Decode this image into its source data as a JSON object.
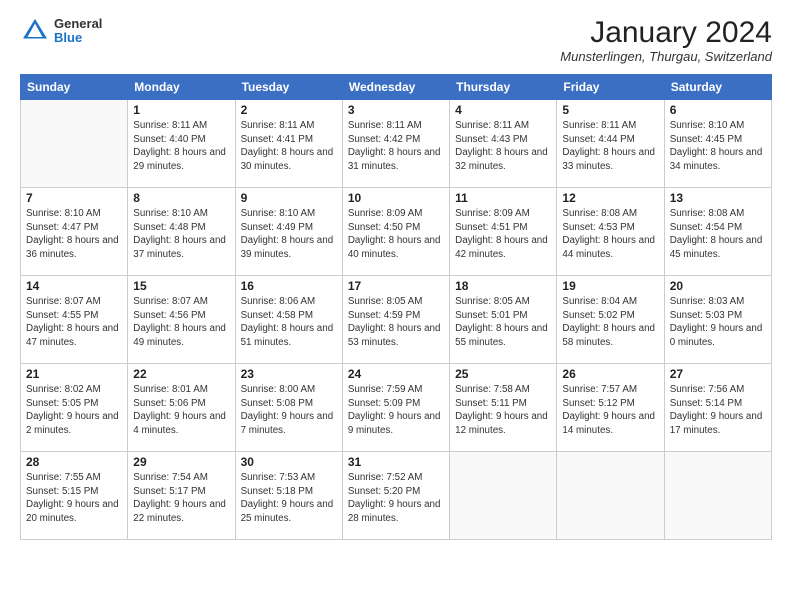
{
  "header": {
    "logo_general": "General",
    "logo_blue": "Blue",
    "month_title": "January 2024",
    "location": "Munsterlingen, Thurgau, Switzerland"
  },
  "weekdays": [
    "Sunday",
    "Monday",
    "Tuesday",
    "Wednesday",
    "Thursday",
    "Friday",
    "Saturday"
  ],
  "weeks": [
    [
      {
        "num": "",
        "sunrise": "",
        "sunset": "",
        "daylight": ""
      },
      {
        "num": "1",
        "sunrise": "Sunrise: 8:11 AM",
        "sunset": "Sunset: 4:40 PM",
        "daylight": "Daylight: 8 hours and 29 minutes."
      },
      {
        "num": "2",
        "sunrise": "Sunrise: 8:11 AM",
        "sunset": "Sunset: 4:41 PM",
        "daylight": "Daylight: 8 hours and 30 minutes."
      },
      {
        "num": "3",
        "sunrise": "Sunrise: 8:11 AM",
        "sunset": "Sunset: 4:42 PM",
        "daylight": "Daylight: 8 hours and 31 minutes."
      },
      {
        "num": "4",
        "sunrise": "Sunrise: 8:11 AM",
        "sunset": "Sunset: 4:43 PM",
        "daylight": "Daylight: 8 hours and 32 minutes."
      },
      {
        "num": "5",
        "sunrise": "Sunrise: 8:11 AM",
        "sunset": "Sunset: 4:44 PM",
        "daylight": "Daylight: 8 hours and 33 minutes."
      },
      {
        "num": "6",
        "sunrise": "Sunrise: 8:10 AM",
        "sunset": "Sunset: 4:45 PM",
        "daylight": "Daylight: 8 hours and 34 minutes."
      }
    ],
    [
      {
        "num": "7",
        "sunrise": "Sunrise: 8:10 AM",
        "sunset": "Sunset: 4:47 PM",
        "daylight": "Daylight: 8 hours and 36 minutes."
      },
      {
        "num": "8",
        "sunrise": "Sunrise: 8:10 AM",
        "sunset": "Sunset: 4:48 PM",
        "daylight": "Daylight: 8 hours and 37 minutes."
      },
      {
        "num": "9",
        "sunrise": "Sunrise: 8:10 AM",
        "sunset": "Sunset: 4:49 PM",
        "daylight": "Daylight: 8 hours and 39 minutes."
      },
      {
        "num": "10",
        "sunrise": "Sunrise: 8:09 AM",
        "sunset": "Sunset: 4:50 PM",
        "daylight": "Daylight: 8 hours and 40 minutes."
      },
      {
        "num": "11",
        "sunrise": "Sunrise: 8:09 AM",
        "sunset": "Sunset: 4:51 PM",
        "daylight": "Daylight: 8 hours and 42 minutes."
      },
      {
        "num": "12",
        "sunrise": "Sunrise: 8:08 AM",
        "sunset": "Sunset: 4:53 PM",
        "daylight": "Daylight: 8 hours and 44 minutes."
      },
      {
        "num": "13",
        "sunrise": "Sunrise: 8:08 AM",
        "sunset": "Sunset: 4:54 PM",
        "daylight": "Daylight: 8 hours and 45 minutes."
      }
    ],
    [
      {
        "num": "14",
        "sunrise": "Sunrise: 8:07 AM",
        "sunset": "Sunset: 4:55 PM",
        "daylight": "Daylight: 8 hours and 47 minutes."
      },
      {
        "num": "15",
        "sunrise": "Sunrise: 8:07 AM",
        "sunset": "Sunset: 4:56 PM",
        "daylight": "Daylight: 8 hours and 49 minutes."
      },
      {
        "num": "16",
        "sunrise": "Sunrise: 8:06 AM",
        "sunset": "Sunset: 4:58 PM",
        "daylight": "Daylight: 8 hours and 51 minutes."
      },
      {
        "num": "17",
        "sunrise": "Sunrise: 8:05 AM",
        "sunset": "Sunset: 4:59 PM",
        "daylight": "Daylight: 8 hours and 53 minutes."
      },
      {
        "num": "18",
        "sunrise": "Sunrise: 8:05 AM",
        "sunset": "Sunset: 5:01 PM",
        "daylight": "Daylight: 8 hours and 55 minutes."
      },
      {
        "num": "19",
        "sunrise": "Sunrise: 8:04 AM",
        "sunset": "Sunset: 5:02 PM",
        "daylight": "Daylight: 8 hours and 58 minutes."
      },
      {
        "num": "20",
        "sunrise": "Sunrise: 8:03 AM",
        "sunset": "Sunset: 5:03 PM",
        "daylight": "Daylight: 9 hours and 0 minutes."
      }
    ],
    [
      {
        "num": "21",
        "sunrise": "Sunrise: 8:02 AM",
        "sunset": "Sunset: 5:05 PM",
        "daylight": "Daylight: 9 hours and 2 minutes."
      },
      {
        "num": "22",
        "sunrise": "Sunrise: 8:01 AM",
        "sunset": "Sunset: 5:06 PM",
        "daylight": "Daylight: 9 hours and 4 minutes."
      },
      {
        "num": "23",
        "sunrise": "Sunrise: 8:00 AM",
        "sunset": "Sunset: 5:08 PM",
        "daylight": "Daylight: 9 hours and 7 minutes."
      },
      {
        "num": "24",
        "sunrise": "Sunrise: 7:59 AM",
        "sunset": "Sunset: 5:09 PM",
        "daylight": "Daylight: 9 hours and 9 minutes."
      },
      {
        "num": "25",
        "sunrise": "Sunrise: 7:58 AM",
        "sunset": "Sunset: 5:11 PM",
        "daylight": "Daylight: 9 hours and 12 minutes."
      },
      {
        "num": "26",
        "sunrise": "Sunrise: 7:57 AM",
        "sunset": "Sunset: 5:12 PM",
        "daylight": "Daylight: 9 hours and 14 minutes."
      },
      {
        "num": "27",
        "sunrise": "Sunrise: 7:56 AM",
        "sunset": "Sunset: 5:14 PM",
        "daylight": "Daylight: 9 hours and 17 minutes."
      }
    ],
    [
      {
        "num": "28",
        "sunrise": "Sunrise: 7:55 AM",
        "sunset": "Sunset: 5:15 PM",
        "daylight": "Daylight: 9 hours and 20 minutes."
      },
      {
        "num": "29",
        "sunrise": "Sunrise: 7:54 AM",
        "sunset": "Sunset: 5:17 PM",
        "daylight": "Daylight: 9 hours and 22 minutes."
      },
      {
        "num": "30",
        "sunrise": "Sunrise: 7:53 AM",
        "sunset": "Sunset: 5:18 PM",
        "daylight": "Daylight: 9 hours and 25 minutes."
      },
      {
        "num": "31",
        "sunrise": "Sunrise: 7:52 AM",
        "sunset": "Sunset: 5:20 PM",
        "daylight": "Daylight: 9 hours and 28 minutes."
      },
      {
        "num": "",
        "sunrise": "",
        "sunset": "",
        "daylight": ""
      },
      {
        "num": "",
        "sunrise": "",
        "sunset": "",
        "daylight": ""
      },
      {
        "num": "",
        "sunrise": "",
        "sunset": "",
        "daylight": ""
      }
    ]
  ]
}
